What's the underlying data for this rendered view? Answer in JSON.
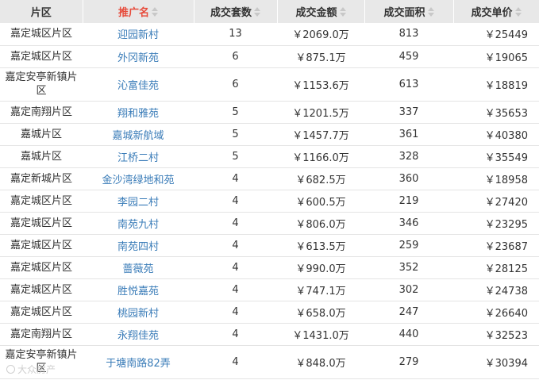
{
  "headers": {
    "district": "片区",
    "community": "推广名",
    "deal_count": "成交套数",
    "deal_amount": "成交金额",
    "deal_area": "成交面积",
    "unit_price": "成交单价"
  },
  "rows": [
    {
      "district": "嘉定城区片区",
      "community": "迎园新村",
      "count": "13",
      "amount": "￥2069.0万",
      "area": "813",
      "price": "￥25449"
    },
    {
      "district": "嘉定城区片区",
      "community": "外冈新苑",
      "count": "6",
      "amount": "￥875.1万",
      "area": "459",
      "price": "￥19065"
    },
    {
      "district": "嘉定安亭新镇片区",
      "community": "沁富佳苑",
      "count": "6",
      "amount": "￥1153.6万",
      "area": "613",
      "price": "￥18819"
    },
    {
      "district": "嘉定南翔片区",
      "community": "翔和雅苑",
      "count": "5",
      "amount": "￥1201.5万",
      "area": "337",
      "price": "￥35653"
    },
    {
      "district": "嘉城片区",
      "community": "嘉城新航域",
      "count": "5",
      "amount": "￥1457.7万",
      "area": "361",
      "price": "￥40380"
    },
    {
      "district": "嘉城片区",
      "community": "江桥二村",
      "count": "5",
      "amount": "￥1166.0万",
      "area": "328",
      "price": "￥35549"
    },
    {
      "district": "嘉定新城片区",
      "community": "金沙湾绿地和苑",
      "count": "4",
      "amount": "￥682.5万",
      "area": "360",
      "price": "￥18958"
    },
    {
      "district": "嘉定城区片区",
      "community": "李园二村",
      "count": "4",
      "amount": "￥600.5万",
      "area": "219",
      "price": "￥27420"
    },
    {
      "district": "嘉定城区片区",
      "community": "南苑九村",
      "count": "4",
      "amount": "￥806.0万",
      "area": "346",
      "price": "￥23295"
    },
    {
      "district": "嘉定城区片区",
      "community": "南苑四村",
      "count": "4",
      "amount": "￥613.5万",
      "area": "259",
      "price": "￥23687"
    },
    {
      "district": "嘉定城区片区",
      "community": "蔷薇苑",
      "count": "4",
      "amount": "￥990.0万",
      "area": "352",
      "price": "￥28125"
    },
    {
      "district": "嘉定城区片区",
      "community": "胜悦嘉苑",
      "count": "4",
      "amount": "￥747.1万",
      "area": "302",
      "price": "￥24738"
    },
    {
      "district": "嘉定城区片区",
      "community": "桃园新村",
      "count": "4",
      "amount": "￥658.0万",
      "area": "247",
      "price": "￥26640"
    },
    {
      "district": "嘉定南翔片区",
      "community": "永翔佳苑",
      "count": "4",
      "amount": "￥1431.0万",
      "area": "440",
      "price": "￥32523"
    },
    {
      "district": "嘉定安亭新镇片区",
      "community": "于塘南路82弄",
      "count": "4",
      "amount": "￥848.0万",
      "area": "279",
      "price": "￥30394"
    }
  ],
  "watermark": "大众房产",
  "colors": {
    "header_bg": "#e8e8e8",
    "active_header": "#e74c3c",
    "link": "#3a7cb8"
  }
}
